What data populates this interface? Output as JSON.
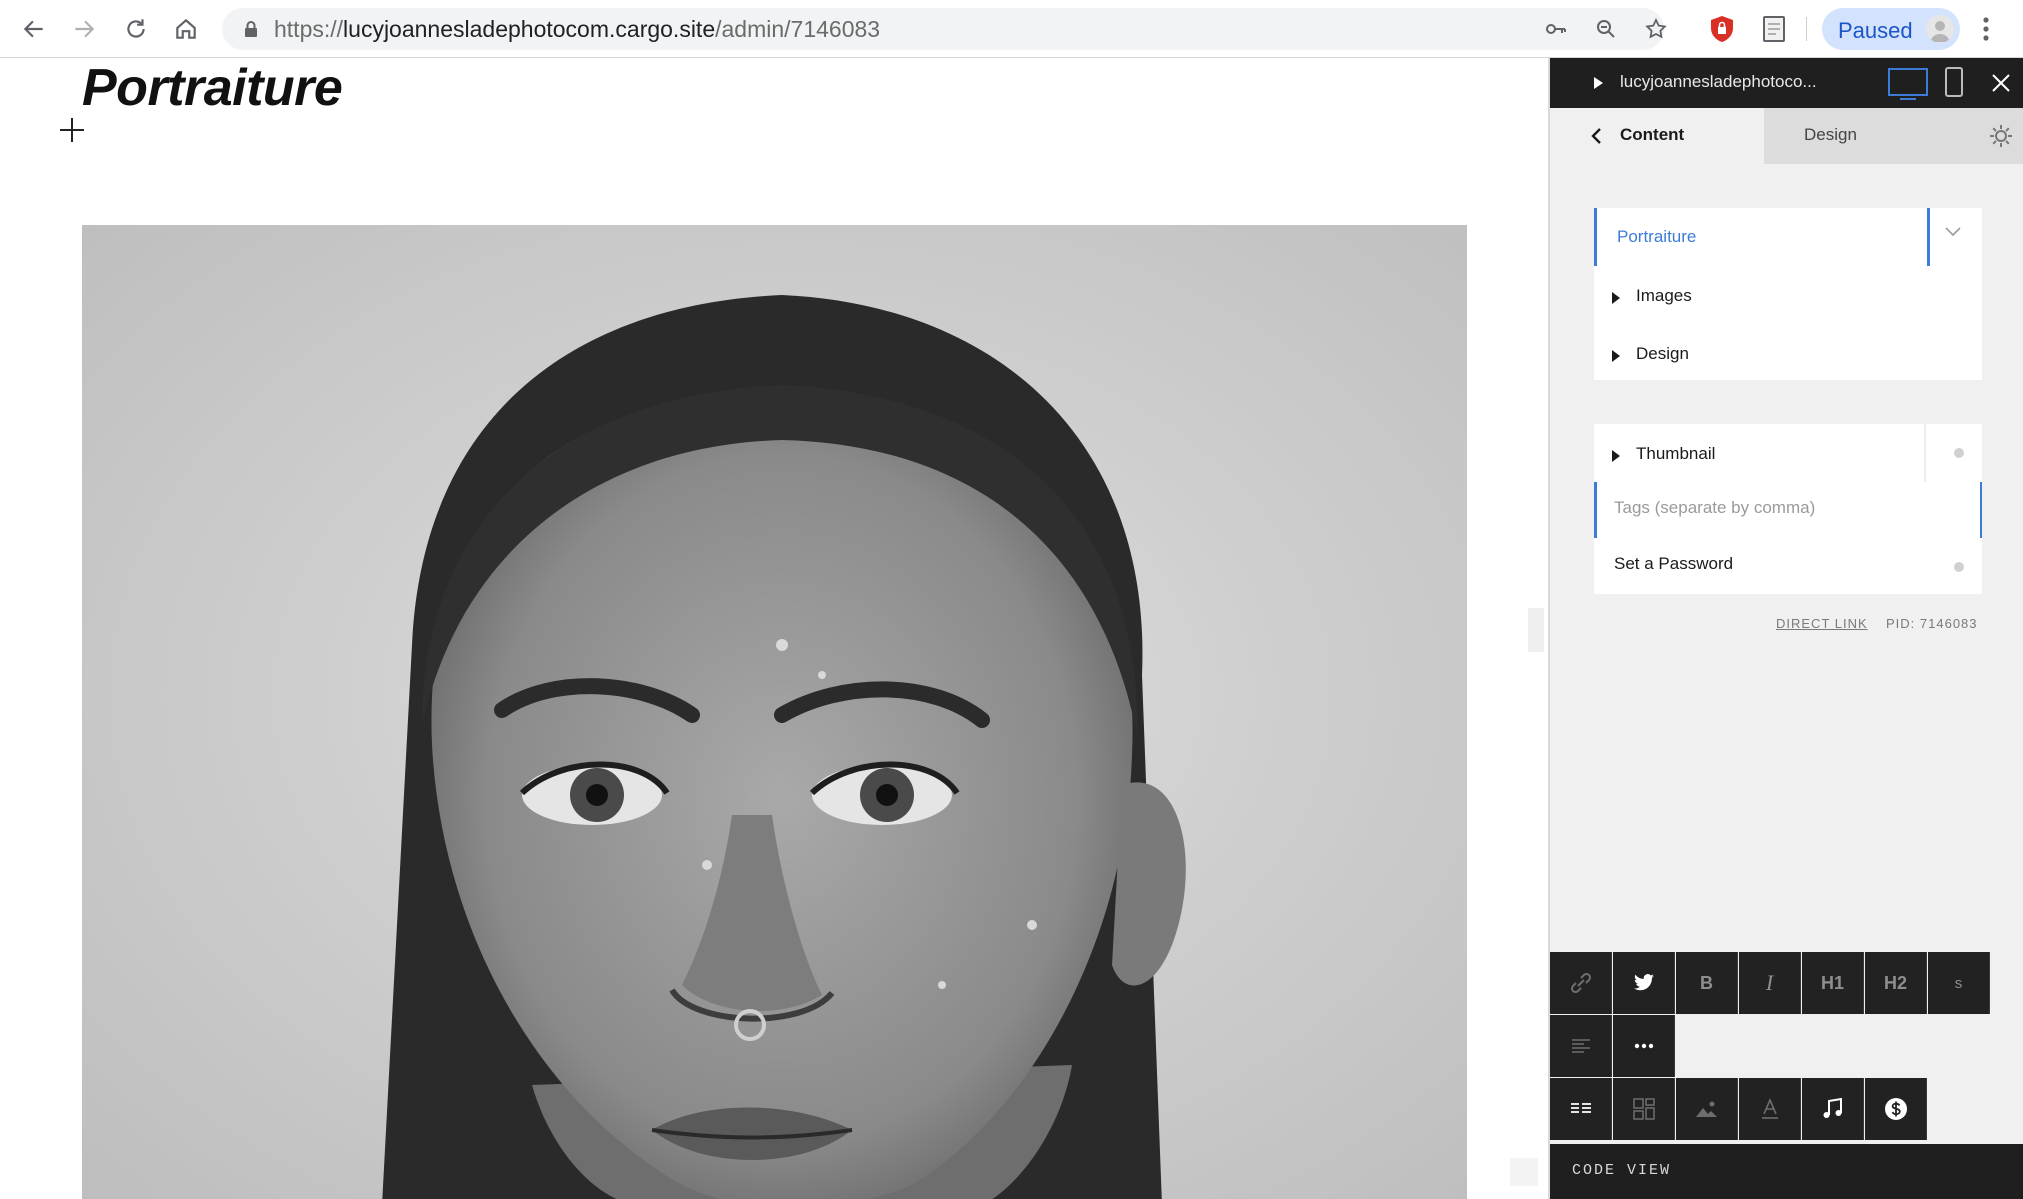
{
  "browser": {
    "url_scheme": "https://",
    "url_host": "lucyjoannesladephotocom.cargo.site",
    "url_path": "/admin/7146083",
    "profile_label": "Paused",
    "icons": [
      "back-arrow-icon",
      "forward-arrow-icon",
      "reload-icon",
      "home-icon",
      "lock-icon",
      "key-icon",
      "zoom-icon",
      "star-icon",
      "shield-extension-icon",
      "page-extension-icon",
      "avatar",
      "kebab-menu-icon"
    ]
  },
  "page": {
    "title": "Portraiture",
    "photo_icon": "portrait-photo"
  },
  "panel": {
    "site_name": "lucyjoannesladephotoco...",
    "tabs": {
      "content": "Content",
      "design": "Design"
    },
    "page_title_value": "Portraiture",
    "sections": [
      {
        "label": "Images"
      },
      {
        "label": "Design"
      }
    ],
    "thumbnail_label": "Thumbnail",
    "tags_placeholder": "Tags (separate by comma)",
    "password_label": "Set a Password",
    "direct_link": "DIRECT LINK",
    "pid": "PID: 7146083"
  },
  "toolbar": {
    "bold": "B",
    "italic": "I",
    "h1": "H1",
    "h2": "H2",
    "small": "s",
    "code_view": "CODE VIEW"
  },
  "colors": {
    "accent": "#3d7bd8",
    "panel_dark": "#1f1f1f",
    "toolbar_button": "#222222",
    "panel_bg": "#f0f0f0",
    "paused_pill": "#d3e3fd"
  }
}
